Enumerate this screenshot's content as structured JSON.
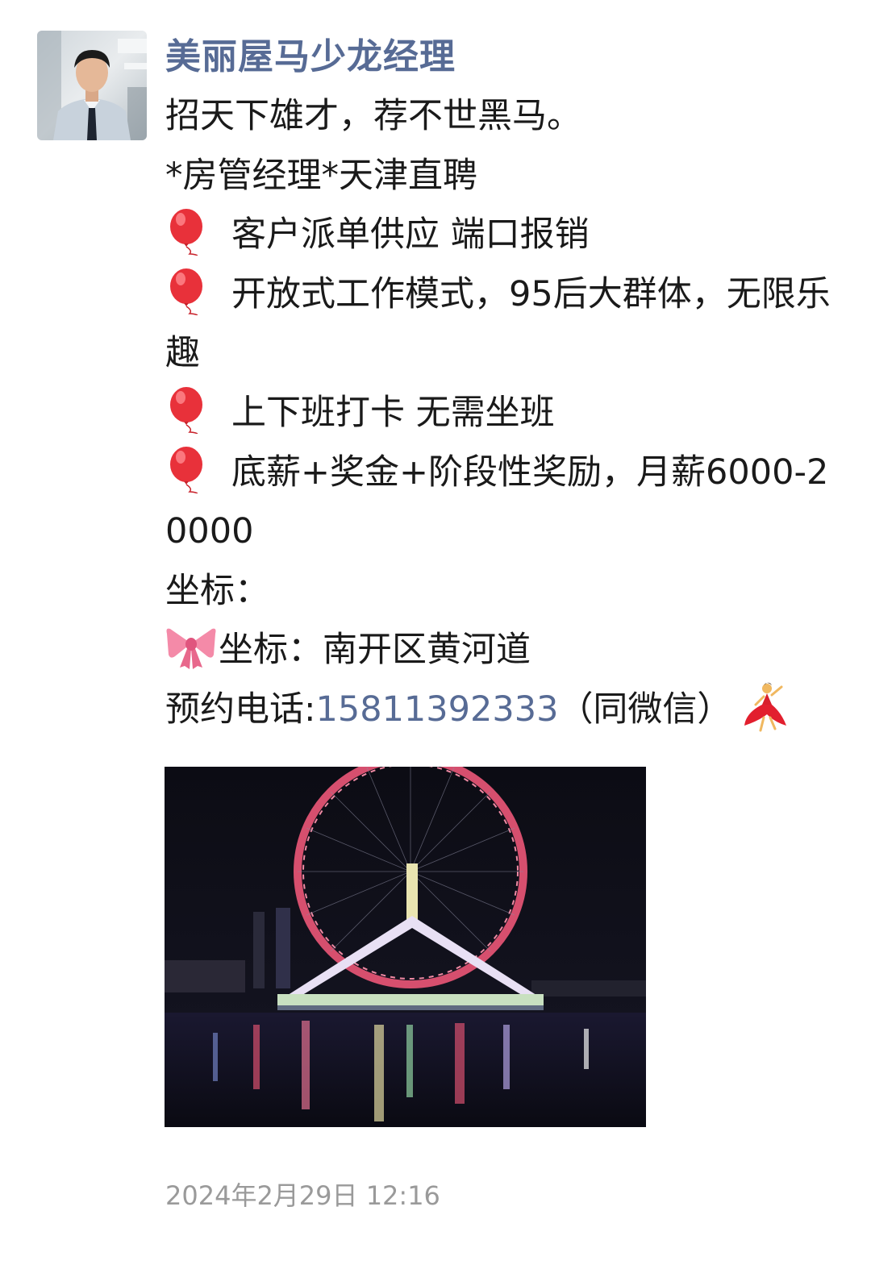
{
  "post": {
    "author_name": "美丽屋马少龙经理",
    "lines": {
      "l1": "招天下雄才，荐不世黑马。",
      "l2": "*房管经理*天津直聘",
      "b1": "客户派单供应 端口报销",
      "b2": "开放式工作模式，95后大群体，无限乐趣",
      "b3": "上下班打卡 无需坐班",
      "b4": "底薪+奖金+阶段性奖励，月薪6000-20000",
      "l3": "坐标：",
      "l4": "坐标：南开区黄河道",
      "phone_label": "预约电话:",
      "phone_number": "15811392333",
      "phone_suffix": "（同微信）"
    },
    "timestamp": "2024年2月29日 12:16"
  },
  "icons": {
    "balloon": "red-balloon-icon",
    "ribbon": "pink-ribbon-icon",
    "dancer": "dancer-icon"
  },
  "colors": {
    "name": "#576b95",
    "link": "#576b95",
    "text": "#1a1a1a",
    "timestamp": "#9a9a9a"
  }
}
